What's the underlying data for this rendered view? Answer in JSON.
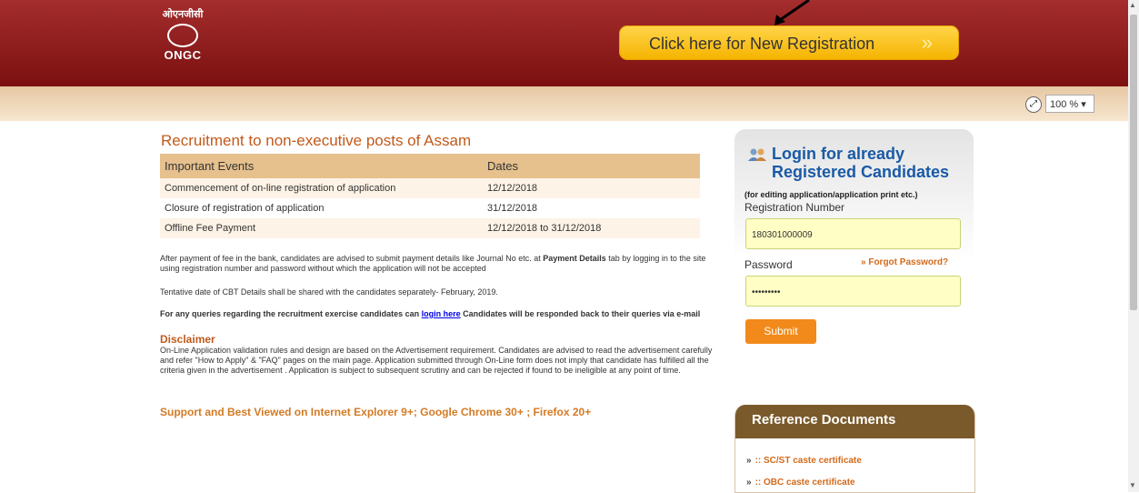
{
  "header": {
    "logo_hindi": "ओएनजीसी",
    "logo_text": "ONGC",
    "registration_button": "Click here for New Registration",
    "registration_chevron": "»"
  },
  "toolbar": {
    "zoom_value": "100 % ▾"
  },
  "main": {
    "title": "Recruitment to non-executive posts of Assam",
    "table": {
      "headers": [
        "Important Events",
        "Dates"
      ],
      "rows": [
        [
          "Commencement of on-line registration of application",
          "12/12/2018"
        ],
        [
          "Closure of registration of application",
          "31/12/2018"
        ],
        [
          "Offline Fee Payment",
          "12/12/2018 to 31/12/2018"
        ]
      ]
    },
    "para1_a": "After payment of fee in the bank, candidates are advised to submit payment details like Journal No etc. at",
    "para1_b": "Payment Details",
    "para1_c": "tab by logging in to the site using registration number and password without which the application will not be accepted",
    "para2": "Tentative date of CBT Details shall be shared with the candidates separately- February, 2019.",
    "query_a": "For any queries regarding the recruitment exercise candidates can",
    "query_link": "login here",
    "query_b": "Candidates will be responded back to their queries via e-mail",
    "disclaimer_heading": "Disclaimer",
    "disclaimer_text": "On-Line Application validation rules and design are based on the Advertisement requirement. Candidates are advised to read the advertisement carefully and refer \"How to Apply\" & \"FAQ\" pages on the main page. Application submitted through On-Line form does not imply that candidate has fulfilled all the criteria given in the advertisement . Application is subject to subsequent scrutiny and can be rejected if found to be ineligible at any point of time.",
    "support": "Support and Best Viewed on Internet Explorer 9+; Google Chrome 30+ ; Firefox 20+"
  },
  "login": {
    "title_line1": "Login for already",
    "title_line2": "Registered Candidates",
    "hint": "(for editing application/application print etc.)",
    "reg_label": "Registration Number",
    "reg_value": "180301000009",
    "password_label": "Password",
    "forgot": "» Forgot Password?",
    "password_value": "•••••••••",
    "submit": "Submit"
  },
  "reference": {
    "heading": "Reference Documents",
    "links": [
      ":: SC/ST caste certificate",
      ":: OBC caste certificate"
    ],
    "chevron": "»"
  }
}
